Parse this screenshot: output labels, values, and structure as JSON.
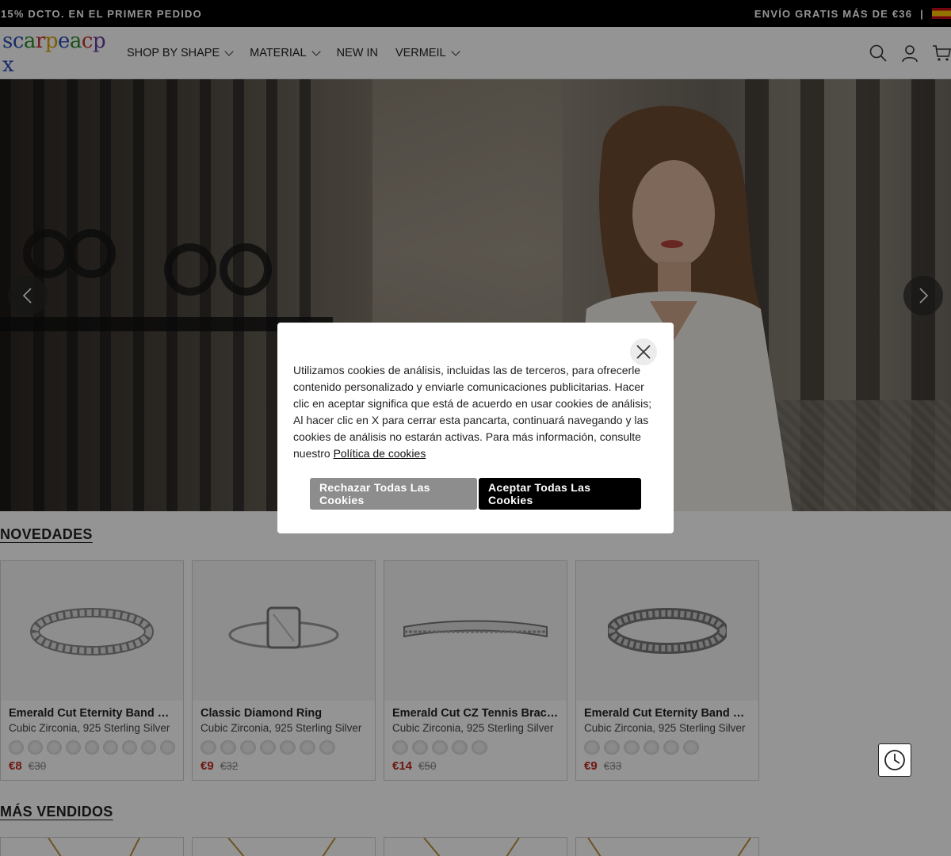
{
  "promo": {
    "left_text": "15% DCTO. EN EL PRIMER PEDIDO",
    "right_text": "ENVÍO GRATIS MÁS DE €36",
    "separator": "|",
    "flag": "spain-flag-icon"
  },
  "header": {
    "logo": [
      "s",
      "c",
      "a",
      "r",
      "p",
      "e",
      "a",
      "c",
      "p",
      "x"
    ],
    "logo_colors": [
      "#2a4db5",
      "#2a4db5",
      "#2a8a2a",
      "#c83030",
      "#d8a000",
      "#2a4db5",
      "#2a8a2a",
      "#c83030",
      "#6a3aa0",
      "#2a4db5"
    ],
    "nav": [
      {
        "label": "SHOP BY SHAPE",
        "has_dropdown": true
      },
      {
        "label": "MATERIAL",
        "has_dropdown": true
      },
      {
        "label": "NEW IN",
        "has_dropdown": false
      },
      {
        "label": "VERMEIL",
        "has_dropdown": true
      }
    ],
    "icons": [
      "search-icon",
      "account-icon",
      "cart-icon"
    ]
  },
  "hero": {
    "prev": "chevron-left-icon",
    "next": "chevron-right-icon"
  },
  "sections": {
    "new_title": "NOVEDADES",
    "best_title": "MÁS VENDIDOS"
  },
  "products": [
    {
      "name": "Emerald Cut Eternity Band Dia...",
      "sub": "Cubic Zirconia, 925 Sterling Silver",
      "price": "€8",
      "old_price": "€30",
      "swatches": 9
    },
    {
      "name": "Classic Diamond Ring",
      "sub": "Cubic Zirconia, 925 Sterling Silver",
      "price": "€9",
      "old_price": "€32",
      "swatches": 7
    },
    {
      "name": "Emerald Cut CZ Tennis Bracelet",
      "sub": "Cubic Zirconia, 925 Sterling Silver",
      "price": "€14",
      "old_price": "€50",
      "swatches": 5
    },
    {
      "name": "Emerald Cut Eternity Band Ring",
      "sub": "Cubic Zirconia, 925 Sterling Silver",
      "price": "€9",
      "old_price": "€33",
      "swatches": 6
    }
  ],
  "cookie": {
    "text": "Utilizamos cookies de análisis, incluidas las de terceros, para ofrecerle contenido personalizado y enviarle comunicaciones publicitarias. Hacer clic en aceptar significa que está de acuerdo en usar cookies de análisis; Al hacer clic en X para cerrar esta pancarta, continuará navegando y las cookies de análisis no estarán activas. Para más información, consulte nuestro",
    "link": "Política de cookies",
    "reject": "Rechazar Todas Las Cookies",
    "accept": "Aceptar Todas Las Cookies",
    "close_icon": "close-icon"
  },
  "floating": {
    "history_icon": "clock-icon"
  }
}
